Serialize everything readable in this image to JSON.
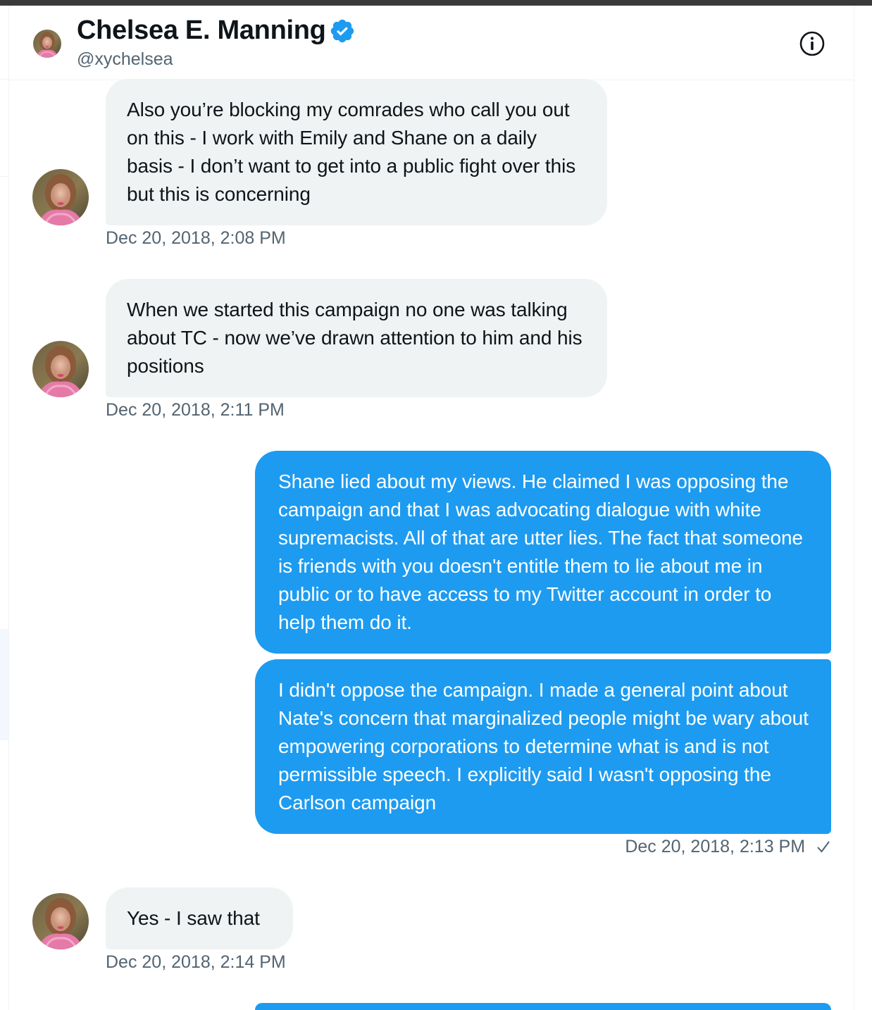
{
  "header": {
    "name": "Chelsea E. Manning",
    "handle": "@xychelsea",
    "verified": true,
    "info_icon": "info-circle-icon"
  },
  "messages": [
    {
      "direction": "received",
      "text": "Also you’re blocking my comrades who call you out on this - I work with Emily and Shane on a daily basis - I don’t want to get into a public fight over this but this is concerning",
      "timestamp": "Dec 20, 2018, 2:08 PM"
    },
    {
      "direction": "received",
      "text": "When we started this campaign no one was talking about TC - now we’ve drawn attention to him and his positions",
      "timestamp": "Dec 20, 2018, 2:11 PM"
    },
    {
      "direction": "sent",
      "text": "Shane lied about my views. He claimed I was opposing the campaign and that I was advocating dialogue with white supremacists. All of that are utter lies. The fact that someone is friends with you doesn't entitle them to lie about me in public or to have access to my Twitter account in order to help them do it."
    },
    {
      "direction": "sent",
      "text": "I didn't oppose the campaign. I made a general point about Nate's concern that marginalized people might be wary about empowering corporations to determine what is and is not permissible speech. I explicitly said I wasn't opposing the Carlson campaign",
      "timestamp": "Dec 20, 2018, 2:13 PM",
      "status_icon": "checkmark-icon"
    },
    {
      "direction": "received",
      "text": "Yes - I saw that",
      "timestamp": "Dec 20, 2018, 2:14 PM"
    },
    {
      "direction": "sent",
      "text": ""
    }
  ],
  "colors": {
    "sent_bubble": "#1d9bf0",
    "received_bubble": "#eff3f4",
    "verified_badge": "#1d9bf0",
    "timestamp_text": "#536471"
  }
}
